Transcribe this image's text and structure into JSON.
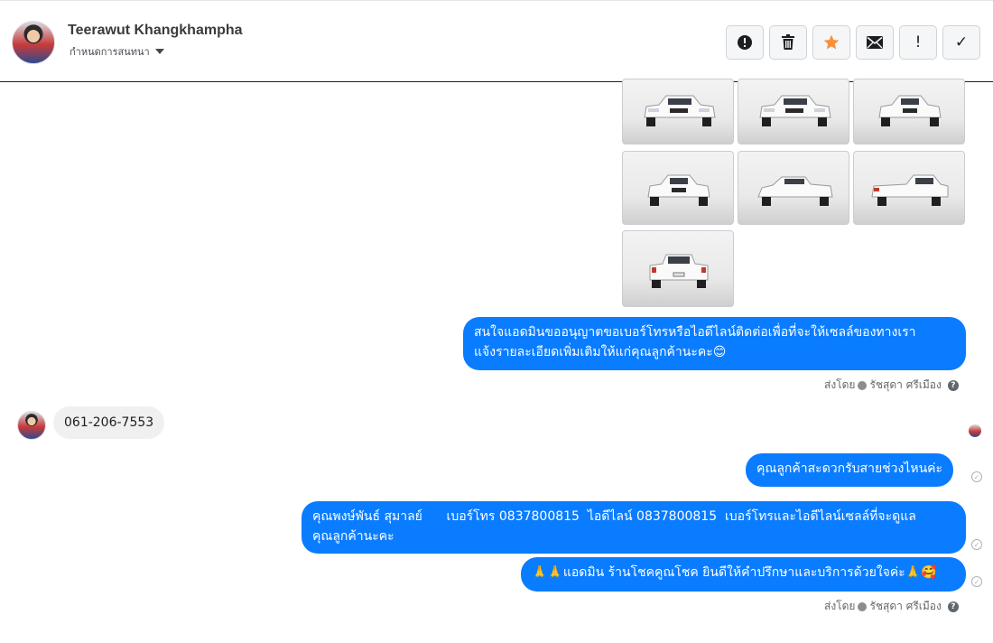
{
  "header": {
    "contact_name": "Teerawut Khangkhampha",
    "subtitle": "กำหนดการสนทนา",
    "toolbar": [
      {
        "name": "spam-button",
        "icon": "alert-circle-icon"
      },
      {
        "name": "delete-button",
        "icon": "trash-icon"
      },
      {
        "name": "star-button",
        "icon": "star-icon"
      },
      {
        "name": "mark-unread-button",
        "icon": "envelope-icon"
      },
      {
        "name": "important-button",
        "icon": "exclamation-icon",
        "label": "!"
      },
      {
        "name": "done-button",
        "icon": "checkmark-icon",
        "label": "✓"
      }
    ]
  },
  "photos": {
    "count": 7
  },
  "messages": {
    "out_1_line1": "สนใจแอดมินขออนุญาตขอเบอร์โทรหรือไอดีไลน์ติดต่อเพื่อที่จะให้เซลล์ของทางเรา",
    "out_1_line2": "แจ้งรายละเอียดเพิ่มเติมให้แก่คุณลูกค้านะคะ😊",
    "sent_by_label_1": "ส่งโดย",
    "sent_by_name_1": "รัชสุดา ศรีเมือง",
    "in_1": "061-206-7553",
    "out_2": "คุณลูกค้าสะดวกรับสายช่วงไหนค่ะ",
    "out_3_line1": "คุณพงษ์พันธ์ สุมาลย์      เบอร์โทร 0837800815  ไอดีไลน์ 0837800815  เบอร์โทรและไอดีไลน์เซลล์ที่จะดูแล",
    "out_3_line2": "คุณลูกค้านะคะ",
    "out_4": "🙏🙏แอดมิน ร้านโชคคูณโชค ยินดีให้คำปรึกษาและบริการด้วยใจค่ะ🙏🥰",
    "sent_by_label_2": "ส่งโดย",
    "sent_by_name_2": "รัชสุดา ศรีเมือง"
  },
  "colors": {
    "outgoing_bubble": "#0a7cff",
    "incoming_bubble": "#f0f0f0",
    "star": "#f7923b"
  }
}
